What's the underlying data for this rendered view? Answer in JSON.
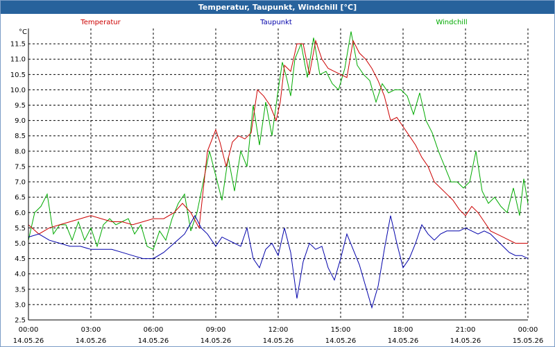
{
  "window": {
    "title": "Temperatur, Taupunkt, Windchill [°C]"
  },
  "chart_data": {
    "type": "line",
    "title": "Temperatur, Taupunkt, Windchill [°C]",
    "ylabel": "°C",
    "xlabel": "",
    "ylim": [
      2.5,
      12.0
    ],
    "y_ticks": [
      "11.5",
      "11.0",
      "10.5",
      "10.0",
      "9.5",
      "9.0",
      "8.5",
      "8.0",
      "7.5",
      "7.0",
      "6.5",
      "6.0",
      "5.5",
      "5.0",
      "4.5",
      "4.0",
      "3.5",
      "3.0",
      "2.5"
    ],
    "xlim": [
      0,
      24
    ],
    "x_ticks": [
      {
        "time": "00:00",
        "date": "14.05.26"
      },
      {
        "time": "03:00",
        "date": "14.05.26"
      },
      {
        "time": "06:00",
        "date": "14.05.26"
      },
      {
        "time": "09:00",
        "date": "14.05.26"
      },
      {
        "time": "12:00",
        "date": "14.05.26"
      },
      {
        "time": "15:00",
        "date": "14.05.26"
      },
      {
        "time": "18:00",
        "date": "14.05.26"
      },
      {
        "time": "21:00",
        "date": "14.05.26"
      },
      {
        "time": "00:00",
        "date": "15.05.26"
      }
    ],
    "grid": true,
    "legend": "top",
    "series": [
      {
        "name": "Temperatur",
        "color": "#cc0000",
        "x": [
          0,
          0.5,
          1,
          1.5,
          2,
          2.5,
          3,
          3.5,
          4,
          4.5,
          5,
          5.5,
          6,
          6.5,
          7,
          7.4,
          7.8,
          8.2,
          8.6,
          9,
          9.2,
          9.5,
          9.8,
          10.1,
          10.4,
          10.7,
          11,
          11.3,
          11.6,
          11.9,
          12.1,
          12.3,
          12.6,
          12.9,
          13.2,
          13.5,
          13.8,
          14.1,
          14.4,
          14.7,
          15,
          15.3,
          15.6,
          15.9,
          16.2,
          16.5,
          16.8,
          17.1,
          17.4,
          17.7,
          18,
          18.3,
          18.6,
          18.9,
          19.2,
          19.5,
          19.8,
          20.1,
          20.4,
          20.7,
          21,
          21.3,
          21.6,
          21.9,
          22.2,
          22.5,
          22.8,
          23.1,
          23.4,
          23.7,
          24
        ],
        "values": [
          5.6,
          5.3,
          5.5,
          5.6,
          5.7,
          5.8,
          5.9,
          5.8,
          5.7,
          5.7,
          5.6,
          5.7,
          5.8,
          5.8,
          6.0,
          6.3,
          6.0,
          5.5,
          8.0,
          8.7,
          8.3,
          7.5,
          8.3,
          8.5,
          8.4,
          8.6,
          10.0,
          9.8,
          9.5,
          9.0,
          9.6,
          10.8,
          10.6,
          11.5,
          11.5,
          10.5,
          11.6,
          11.0,
          10.7,
          10.6,
          10.5,
          10.4,
          11.6,
          11.2,
          11.0,
          10.7,
          10.3,
          9.8,
          9.0,
          9.1,
          8.8,
          8.5,
          8.2,
          7.8,
          7.5,
          7.0,
          6.8,
          6.6,
          6.4,
          6.1,
          5.9,
          6.2,
          6.0,
          5.7,
          5.4,
          5.3,
          5.2,
          5.1,
          5.0,
          5.0,
          5.0
        ]
      },
      {
        "name": "Taupunkt",
        "color": "#0000aa",
        "x": [
          0,
          0.5,
          1,
          1.5,
          2,
          2.5,
          3,
          3.5,
          4,
          4.5,
          5,
          5.5,
          6,
          6.5,
          7,
          7.5,
          8,
          8.3,
          8.6,
          9,
          9.3,
          9.6,
          9.9,
          10.2,
          10.5,
          10.8,
          11.1,
          11.4,
          11.7,
          12,
          12.3,
          12.6,
          12.9,
          13.2,
          13.5,
          13.8,
          14.1,
          14.4,
          14.7,
          15,
          15.3,
          15.6,
          15.9,
          16.2,
          16.5,
          16.8,
          17.1,
          17.4,
          17.7,
          18,
          18.3,
          18.6,
          18.9,
          19.2,
          19.5,
          19.8,
          20.1,
          20.4,
          20.7,
          21,
          21.3,
          21.6,
          21.9,
          22.2,
          22.5,
          22.8,
          23.1,
          23.4,
          23.7,
          24
        ],
        "values": [
          5.2,
          5.3,
          5.1,
          5.0,
          4.9,
          4.9,
          4.8,
          4.8,
          4.8,
          4.7,
          4.6,
          4.5,
          4.5,
          4.7,
          5.0,
          5.3,
          5.9,
          5.5,
          5.3,
          4.9,
          5.2,
          5.1,
          5.0,
          4.9,
          5.5,
          4.5,
          4.2,
          4.8,
          5.0,
          4.6,
          5.5,
          4.7,
          3.2,
          4.4,
          5.0,
          4.8,
          4.9,
          4.2,
          3.8,
          4.5,
          5.3,
          4.8,
          4.3,
          3.6,
          2.9,
          3.6,
          4.8,
          5.9,
          5.0,
          4.2,
          4.5,
          5.0,
          5.6,
          5.3,
          5.1,
          5.3,
          5.4,
          5.4,
          5.4,
          5.5,
          5.4,
          5.3,
          5.4,
          5.3,
          5.1,
          4.9,
          4.7,
          4.6,
          4.6,
          4.5
        ]
      },
      {
        "name": "Windchill",
        "color": "#00aa00",
        "x": [
          0,
          0.3,
          0.6,
          0.9,
          1.2,
          1.5,
          1.8,
          2.1,
          2.4,
          2.7,
          3,
          3.3,
          3.6,
          3.9,
          4.2,
          4.5,
          4.8,
          5.1,
          5.4,
          5.7,
          6,
          6.3,
          6.6,
          6.9,
          7.2,
          7.5,
          7.8,
          8.1,
          8.4,
          8.7,
          9,
          9.3,
          9.6,
          9.9,
          10.2,
          10.5,
          10.8,
          11.1,
          11.4,
          11.7,
          12,
          12.2,
          12.4,
          12.6,
          12.8,
          13.1,
          13.4,
          13.7,
          14,
          14.3,
          14.6,
          14.9,
          15.2,
          15.5,
          15.8,
          16.1,
          16.4,
          16.7,
          17,
          17.3,
          17.6,
          17.9,
          18.2,
          18.5,
          18.8,
          19.1,
          19.4,
          19.7,
          20,
          20.3,
          20.6,
          20.9,
          21.2,
          21.5,
          21.8,
          22.1,
          22.4,
          22.7,
          23,
          23.3,
          23.6,
          23.8,
          24
        ],
        "values": [
          5.1,
          6.0,
          6.2,
          6.6,
          5.3,
          5.6,
          5.6,
          5.1,
          5.7,
          5.1,
          5.5,
          4.9,
          5.6,
          5.8,
          5.6,
          5.7,
          5.8,
          5.3,
          5.6,
          4.9,
          4.8,
          5.4,
          5.1,
          5.8,
          6.3,
          6.6,
          5.4,
          6.0,
          7.0,
          8.0,
          7.2,
          6.4,
          7.8,
          6.7,
          8.0,
          7.5,
          9.5,
          8.2,
          9.6,
          8.5,
          10.0,
          10.9,
          10.4,
          9.8,
          11.0,
          11.5,
          10.4,
          11.7,
          10.5,
          10.6,
          10.2,
          10.0,
          10.7,
          11.9,
          10.8,
          10.5,
          10.3,
          9.6,
          10.2,
          9.9,
          10.0,
          10.0,
          9.8,
          9.2,
          9.9,
          9.0,
          8.6,
          8.0,
          7.5,
          7.0,
          7.0,
          6.8,
          7.0,
          8.0,
          6.7,
          6.3,
          6.5,
          6.2,
          6.0,
          6.8,
          5.9,
          7.1,
          6.3
        ]
      }
    ]
  }
}
